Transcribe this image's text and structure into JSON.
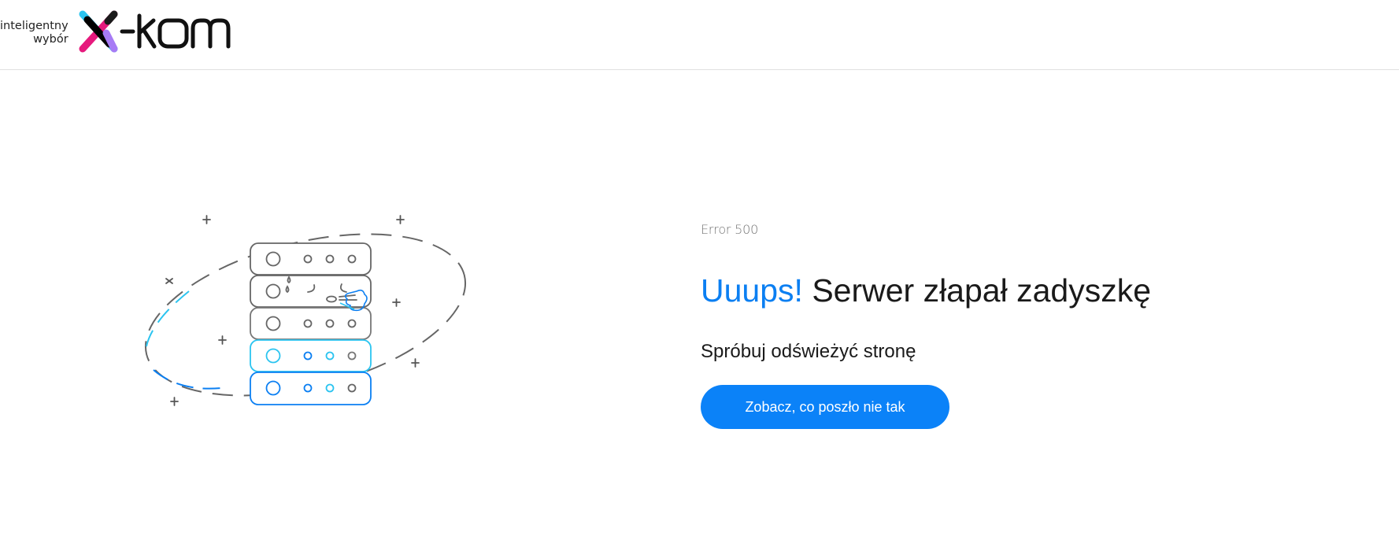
{
  "header": {
    "logo": {
      "tagline_line1": "inteligentny",
      "tagline_line2": "wybór",
      "brand_text": "x-kom"
    }
  },
  "main": {
    "error_code": "Error 500",
    "headline_accent": "Uuups!",
    "headline_rest": " Serwer złapał zadyszkę",
    "subline": "Spróbuj odświeżyć stronę",
    "cta_label": "Zobacz, co poszło nie tak"
  },
  "colors": {
    "accent": "#0b7ff2",
    "button": "#0b82f8",
    "logo_cyan": "#2bc4f0",
    "logo_magenta": "#e6197d",
    "logo_purple": "#a77bf5"
  },
  "illustration": {
    "icon": "tired-server-icon"
  }
}
